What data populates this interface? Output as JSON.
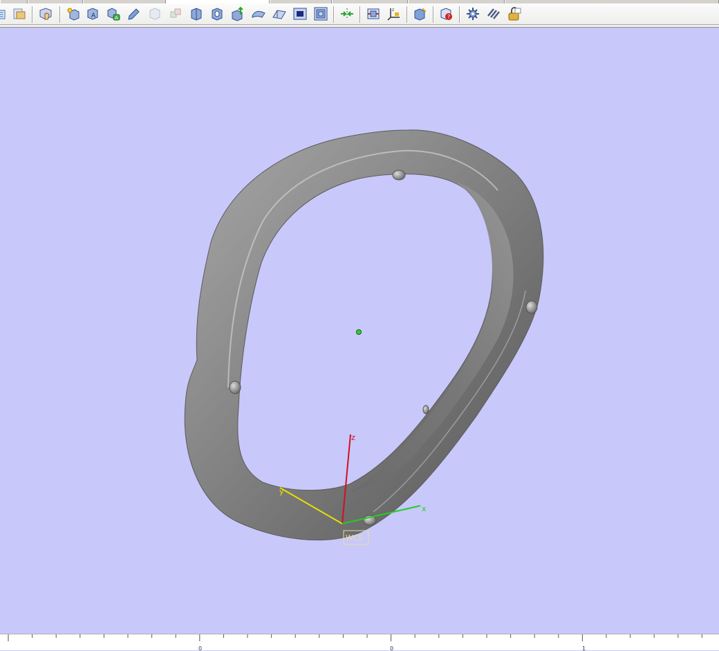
{
  "toolbar": {
    "icons": [
      "new-document-icon",
      "open-folder-icon",
      "hand-pan-icon",
      "create-sketch-icon",
      "part-a-icon",
      "assembly-a-icon",
      "edit-icon",
      "ghost-box-icon",
      "ghost-cubes-icon",
      "extrude-icon",
      "hole-icon",
      "pull-up-icon",
      "surface-icon",
      "sheet-icon",
      "box-dark-icon",
      "frame-icon",
      "mirror-arrows-icon",
      "section-cut-icon",
      "csys-icon",
      "measure-cube-icon",
      "info-cube-icon",
      "gear-icon",
      "layers-icon",
      "lock-open-icon"
    ]
  },
  "viewport": {
    "background_color": "#c8c8fa",
    "model_color": "#8c8c8c"
  },
  "wcs": {
    "label": "WCS",
    "x_label": "x",
    "y_label": "y",
    "z_label": "z",
    "x_color": "#20d020",
    "y_color": "#e8e000",
    "z_color": "#d01020"
  },
  "ruler": {
    "tick_labels": [
      "0",
      "0",
      "1"
    ]
  }
}
